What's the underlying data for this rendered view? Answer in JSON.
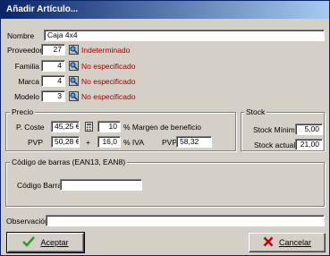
{
  "window": {
    "title": "Añadir Artículo..."
  },
  "nombre": {
    "label": "Nombre",
    "value": "Caja 4x4"
  },
  "refs": [
    {
      "label": "Proveedor",
      "code": "27",
      "text": "Indeterminado"
    },
    {
      "label": "Familia",
      "code": "4",
      "text": "No especificado"
    },
    {
      "label": "Marca",
      "code": "4",
      "text": "No especificado"
    },
    {
      "label": "Modelo",
      "code": "3",
      "text": "No especificado"
    }
  ],
  "precio": {
    "group_label": "Precio",
    "pcoste_label": "P. Coste",
    "pcoste_value": "45,25 €",
    "margen_value": "10",
    "margen_label": "% Margen de beneficio",
    "pvp_label": "PVP",
    "pvp_value": "50,28 €",
    "plus": "+",
    "iva_value": "16,0",
    "iva_label": "% IVA",
    "pvp2_label": "PVP",
    "pvp2_value": "58,32"
  },
  "stock": {
    "group_label": "Stock",
    "min_label": "Stock Mínimo",
    "min_value": "5,00",
    "actual_label": "Stock actual",
    "actual_value": "21,00"
  },
  "barcode": {
    "group_label": "Código de barras (EAN13, EAN8)",
    "label": "Código Barras",
    "value": ""
  },
  "observacion": {
    "label": "Observación",
    "value": ""
  },
  "buttons": {
    "accept": "Aceptar",
    "cancel": "Cancelar"
  },
  "colors": {
    "title_start": "#0a246a",
    "title_end": "#a6caf0",
    "link": "#a00000"
  }
}
